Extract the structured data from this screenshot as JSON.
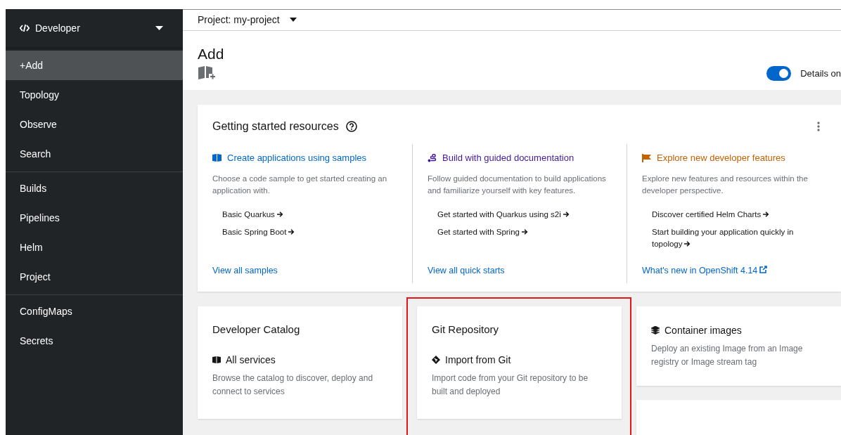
{
  "sidebar": {
    "perspective": "Developer",
    "groups": [
      {
        "items": [
          {
            "label": "+Add",
            "selected": true
          },
          {
            "label": "Topology",
            "selected": false
          },
          {
            "label": "Observe",
            "selected": false
          },
          {
            "label": "Search",
            "selected": false
          }
        ]
      },
      {
        "items": [
          {
            "label": "Builds",
            "selected": false
          },
          {
            "label": "Pipelines",
            "selected": false
          },
          {
            "label": "Helm",
            "selected": false
          },
          {
            "label": "Project",
            "selected": false
          }
        ]
      },
      {
        "items": [
          {
            "label": "ConfigMaps",
            "selected": false
          },
          {
            "label": "Secrets",
            "selected": false
          }
        ]
      }
    ]
  },
  "project_bar": {
    "label": "Project: my-project"
  },
  "page": {
    "title": "Add",
    "details_toggle": {
      "label": "Details on",
      "on": true
    }
  },
  "getting_started": {
    "title": "Getting started resources",
    "columns": [
      {
        "kind": "samples",
        "title": "Create applications using samples",
        "color": "#0066cc",
        "description": "Choose a code sample to get started creating an application with.",
        "links": [
          "Basic Quarkus",
          "Basic Spring Boot"
        ],
        "footer": "View all samples",
        "external": false
      },
      {
        "kind": "guided",
        "title": "Build with guided documentation",
        "color": "#40199a",
        "description": "Follow guided documentation to build applications and familiarize yourself with key features.",
        "links": [
          "Get started with Quarkus using s2i",
          "Get started with Spring"
        ],
        "footer": "View all quick starts",
        "external": false
      },
      {
        "kind": "features",
        "title": "Explore new developer features",
        "color": "#c46100",
        "description": "Explore new features and resources within the developer perspective.",
        "links": [
          "Discover certified Helm Charts",
          "Start building your application quickly in topology"
        ],
        "footer": "What's new in OpenShift 4.14",
        "external": true
      }
    ]
  },
  "cards": [
    {
      "title": "Developer Catalog",
      "item": {
        "kind": "catalog",
        "label": "All services",
        "description": "Browse the catalog to discover, deploy and connect to services"
      },
      "highlighted": false
    },
    {
      "title": "Git Repository",
      "item": {
        "kind": "git",
        "label": "Import from Git",
        "description": "Import code from your Git repository to be built and deployed"
      },
      "highlighted": true
    }
  ],
  "side_cards": [
    {
      "kind": "container",
      "label": "Container images",
      "description": "Deploy an existing Image from an Image registry or Image stream tag"
    },
    {
      "kind": "cut"
    }
  ]
}
